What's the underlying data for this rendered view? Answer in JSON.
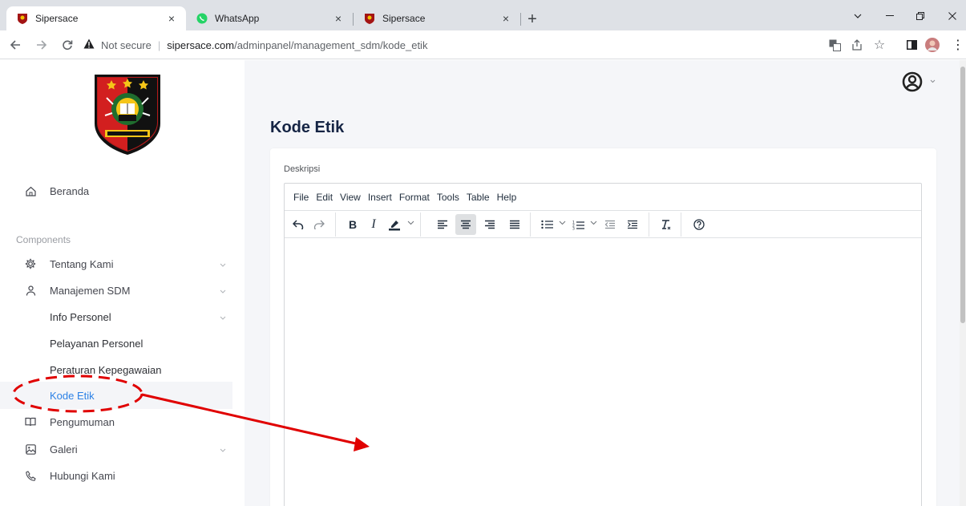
{
  "browser": {
    "tabs": [
      {
        "title": "Sipersace",
        "active": true
      },
      {
        "title": "WhatsApp",
        "active": false
      },
      {
        "title": "Sipersace",
        "active": false
      }
    ],
    "new_tab": "+",
    "address": {
      "security_label": "Not secure",
      "host": "sipersace.com",
      "path": "/adminpanel/management_sdm/kode_etik"
    }
  },
  "sidebar": {
    "home": {
      "label": "Beranda",
      "icon": "home-icon"
    },
    "section_label": "Components",
    "items": [
      {
        "label": "Tentang Kami",
        "icon": "gear-icon",
        "expandable": true
      },
      {
        "label": "Manajemen SDM",
        "icon": "user-icon",
        "expandable": true
      },
      {
        "label": "Info Personel",
        "expandable": true
      },
      {
        "label": "Pelayanan Personel"
      },
      {
        "label": "Peraturan Kepegawaian"
      },
      {
        "label": "Kode Etik",
        "active": true
      },
      {
        "label": "Pengumuman",
        "icon": "book-icon"
      },
      {
        "label": "Galeri",
        "icon": "image-icon",
        "expandable": true
      },
      {
        "label": "Hubungi Kami",
        "icon": "phone-icon"
      }
    ]
  },
  "main": {
    "page_title": "Kode Etik",
    "field_label": "Deskripsi",
    "editor": {
      "menu": [
        "File",
        "Edit",
        "View",
        "Insert",
        "Format",
        "Tools",
        "Table",
        "Help"
      ],
      "toolbar": [
        "undo",
        "redo",
        "bold",
        "italic",
        "highlight-color",
        "align-left",
        "align-center",
        "align-right",
        "align-justify",
        "bullet-list",
        "numbered-list",
        "outdent",
        "indent",
        "clear-formatting",
        "help"
      ],
      "pressed": "align-center",
      "content": ""
    }
  },
  "colors": {
    "accent": "#2d82e6",
    "title": "#152444",
    "annotation": "#e00000",
    "main_bg": "#f5f6f9"
  }
}
